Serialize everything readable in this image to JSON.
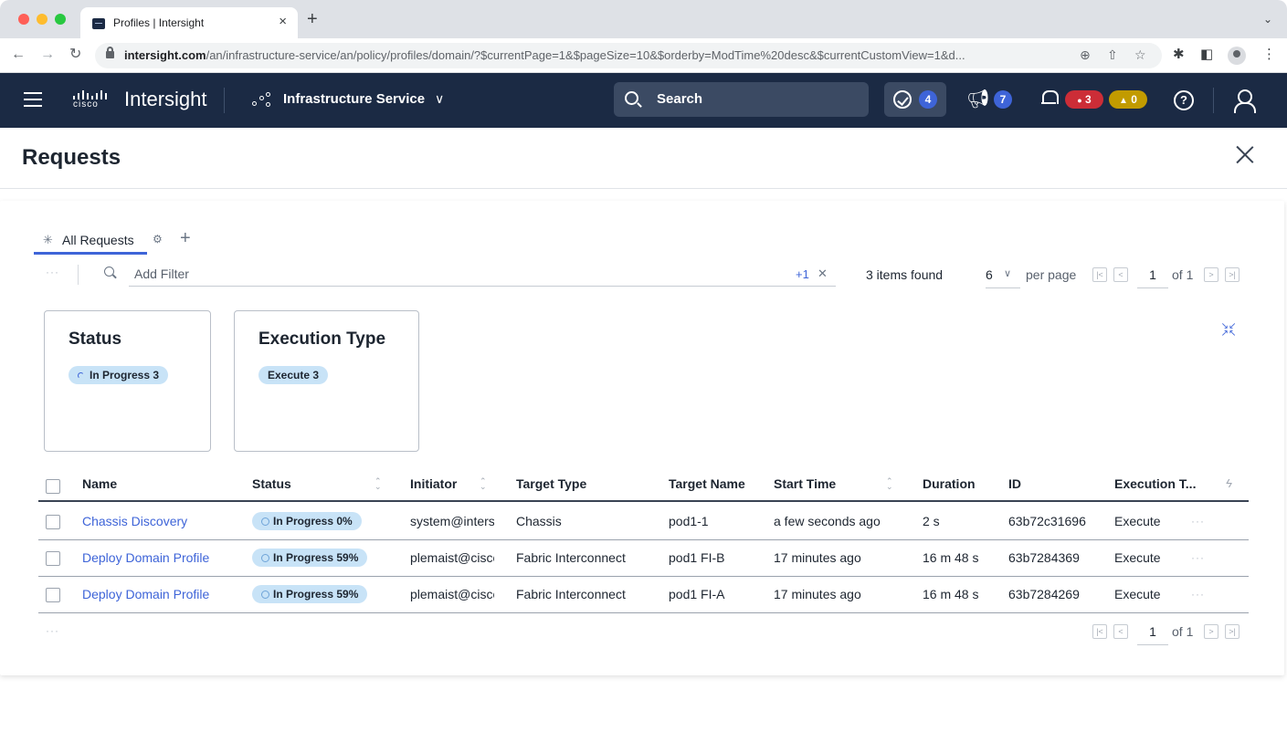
{
  "browser": {
    "tab_title": "Profiles | Intersight",
    "tab_close": "×",
    "new_tab": "+",
    "url_host": "intersight.com",
    "url_path": "/an/infrastructure-service/an/policy/profiles/domain/?$currentPage=1&$pageSize=10&$orderby=ModTime%20desc&$currentCustomView=1&d..."
  },
  "app": {
    "brand": "Intersight",
    "logo_text": "cisco",
    "service": "Infrastructure Service",
    "search_placeholder": "Search",
    "tasks_count": "4",
    "announcements_count": "7",
    "alarms_critical": "3",
    "alarms_warning": "0"
  },
  "page": {
    "title": "Requests"
  },
  "views": {
    "active_tab": "All Requests"
  },
  "filter": {
    "placeholder": "Add Filter",
    "extra_filters": "+1",
    "items_found": "3 items found",
    "per_page_value": "6",
    "per_page_label": "per page",
    "current_page": "1",
    "of_pages": "of 1"
  },
  "widgets": [
    {
      "title": "Status",
      "chip": "In Progress 3"
    },
    {
      "title": "Execution Type",
      "chip": "Execute 3"
    }
  ],
  "table": {
    "columns": [
      "Name",
      "Status",
      "Initiator",
      "Target Type",
      "Target Name",
      "Start Time",
      "Duration",
      "ID",
      "Execution T..."
    ],
    "rows": [
      {
        "name": "Chassis Discovery",
        "status": "In Progress 0%",
        "initiator": "system@intersight",
        "target_type": "Chassis",
        "target_name": "pod1-1",
        "start_time": "a few seconds ago",
        "duration": "2 s",
        "id": "63b72c31696",
        "execution_type": "Execute"
      },
      {
        "name": "Deploy Domain Profile",
        "status": "In Progress 59%",
        "initiator": "plemaist@cisco.com",
        "target_type": "Fabric Interconnect",
        "target_name": "pod1 FI-B",
        "start_time": "17 minutes ago",
        "duration": "16 m 48 s",
        "id": "63b7284369",
        "execution_type": "Execute"
      },
      {
        "name": "Deploy Domain Profile",
        "status": "In Progress 59%",
        "initiator": "plemaist@cisco.com",
        "target_type": "Fabric Interconnect",
        "target_name": "pod1 FI-A",
        "start_time": "17 minutes ago",
        "duration": "16 m 48 s",
        "id": "63b7284269",
        "execution_type": "Execute"
      }
    ]
  },
  "footer_pagination": {
    "current_page": "1",
    "of_pages": "of 1"
  }
}
